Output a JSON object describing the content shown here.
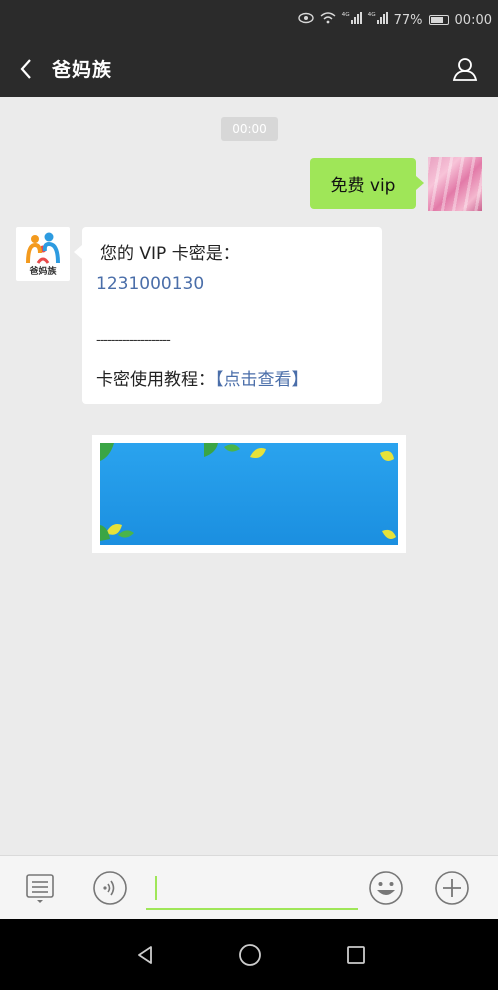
{
  "status_bar": {
    "battery": "77%",
    "time": "00:00",
    "signal_a": "⁴ᴳ",
    "signal_b": "⁴ᴳ"
  },
  "header": {
    "title": "爸妈族"
  },
  "chat": {
    "timestamp": "00:00",
    "outgoing_message": "免费 vip",
    "incoming": {
      "sender_logo_text": "爸妈族",
      "line1": "您的 VIP 卡密是：",
      "code": "1231000130",
      "divider": "--------------------",
      "tutorial_label": "卡密使用教程：",
      "tutorial_link": "【点击查看】"
    }
  },
  "colors": {
    "accent_green": "#9fe658",
    "link_blue": "#4a6ea9",
    "header_bg": "#2b2b2b",
    "chat_bg": "#ebebeb"
  },
  "icons": {
    "back": "chevron-left-icon",
    "profile": "person-icon",
    "menu": "list-menu-icon",
    "voice": "voice-icon",
    "emoji": "emoji-icon",
    "plus": "plus-icon",
    "nav_back": "triangle-back-icon",
    "nav_home": "circle-home-icon",
    "nav_recents": "square-recents-icon"
  }
}
